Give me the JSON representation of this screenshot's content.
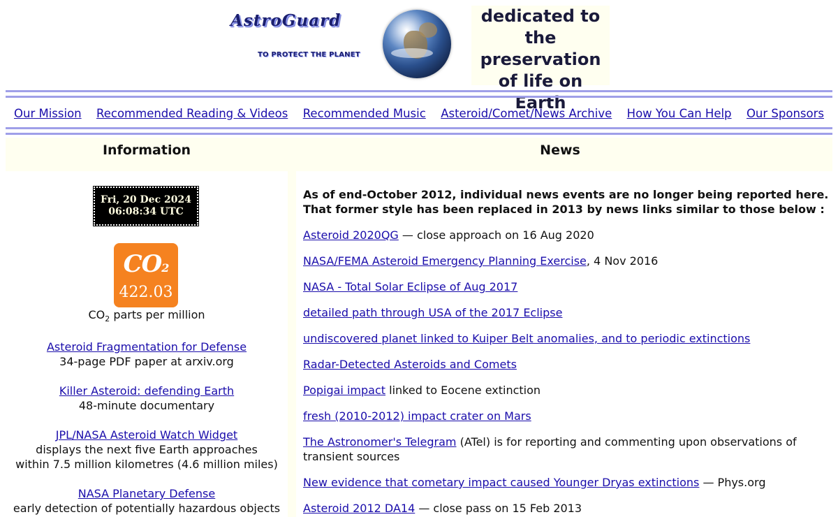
{
  "header": {
    "logo_title": "AstroGuard",
    "logo_subtitle": "TO PROTECT THE PLANET",
    "tagline": "dedicated to the preservation of life on Earth"
  },
  "nav": {
    "items": [
      {
        "label": "Our Mission"
      },
      {
        "label": "Recommended Reading & Videos"
      },
      {
        "label": "Recommended Music"
      },
      {
        "label": "Asteroid/Comet/News Archive"
      },
      {
        "label": "How You Can Help"
      },
      {
        "label": "Our Sponsors"
      }
    ]
  },
  "columns": {
    "left_heading": "Information",
    "right_heading": "News"
  },
  "clock": {
    "date": "Fri, 20 Dec 2024",
    "time": "06:08:34 UTC"
  },
  "co2": {
    "label_main": "CO",
    "label_sub": "2",
    "value": "422.03",
    "caption_pre": "CO",
    "caption_sub": "2",
    "caption_post": " parts per million",
    "badge_color": "#f58220"
  },
  "info": {
    "items": [
      {
        "link": "Asteroid Fragmentation for Defense",
        "desc": "34-page PDF paper at arxiv.org"
      },
      {
        "link": "Killer Asteroid: defending Earth",
        "desc": "48-minute documentary"
      },
      {
        "link": "JPL/NASA Asteroid Watch Widget",
        "desc": "displays the next five Earth approaches",
        "desc2": "within 7.5 million kilometres (4.6 million miles)"
      },
      {
        "link": "NASA Planetary Defense",
        "desc": "early detection of potentially hazardous objects"
      }
    ]
  },
  "news": {
    "notice_line1": "As of end-October 2012, individual news events are no longer being reported here.",
    "notice_line2": "That former style has been replaced in 2013 by news links similar to those below :",
    "items": [
      {
        "link": "Asteroid 2020QG",
        "text": " — close approach on 16 Aug 2020"
      },
      {
        "link": "NASA/FEMA Asteroid Emergency Planning Exercise",
        "text": ", 4 Nov 2016"
      },
      {
        "link": "NASA - Total Solar Eclipse of Aug 2017",
        "text": ""
      },
      {
        "link": "detailed path through USA of the 2017 Eclipse",
        "text": ""
      },
      {
        "link": "undiscovered planet linked to Kuiper Belt anomalies, and to periodic extinctions",
        "text": ""
      },
      {
        "link": "Radar-Detected Asteroids and Comets",
        "text": ""
      },
      {
        "link": "Popigai impact",
        "text": " linked to Eocene extinction"
      },
      {
        "link": "fresh (2010-2012) impact crater on Mars",
        "text": ""
      },
      {
        "link": "The Astronomer's Telegram",
        "text": " (ATel) is for reporting and commenting upon observations of transient sources"
      },
      {
        "link": "New evidence that cometary impact caused Younger Dryas extinctions",
        "text": " — Phys.org"
      },
      {
        "link": "Asteroid 2012 DA14",
        "text": " — close pass on 15 Feb 2013"
      }
    ]
  },
  "colors": {
    "rule": "#9f9fe8",
    "panel_bg": "#fffff0",
    "link": "#1a0dab"
  }
}
